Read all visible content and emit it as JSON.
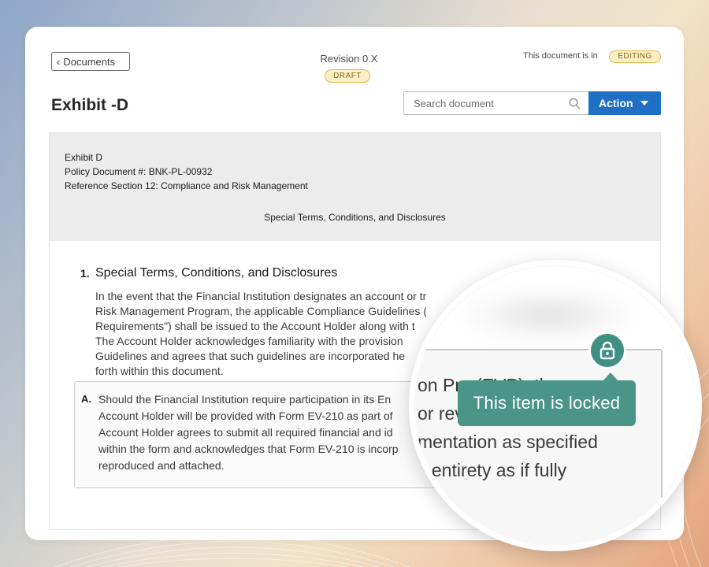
{
  "header": {
    "back_label": "Documents",
    "revision": "Revision 0.X",
    "revision_badge": "DRAFT",
    "status_prefix": "This document is in",
    "status_badge": "EDITING",
    "title": "Exhibit -D"
  },
  "search": {
    "placeholder": "Search document"
  },
  "action": {
    "label": "Action"
  },
  "document": {
    "header_lines": [
      "Exhibit D",
      "Policy Document #: BNK-PL-00932",
      "Reference Section 12: Compliance and Risk Management"
    ],
    "header_center": "Special Terms, Conditions, and Disclosures",
    "section": {
      "number": "1.",
      "title": "Special Terms, Conditions, and Disclosures",
      "paragraph_lines": [
        "In the event that the Financial Institution designates an account or tran",
        "Risk Management Program, the applicable Compliance Guidelines (\"",
        "Requirements\") shall be issued to the Account Holder along with t",
        "The Account Holder acknowledges familiarity with the provision",
        "Guidelines and agrees that such guidelines are incorporated he",
        "forth within this document."
      ]
    },
    "subsection": {
      "letter": "A.",
      "lines": [
        "Should the Financial Institution require participation in its En",
        "Account Holder will be provided with Form EV-210 as part of",
        "Account Holder agrees to submit all required financial and id",
        "within the form and acknowledges that Form EV-210 is incorp",
        "reproduced and attached."
      ]
    }
  },
  "magnifier": {
    "lines": [
      "on Pro          (EVP), th",
      "or rev",
      "mentation as specified",
      "s entirety as if fully"
    ],
    "tooltip": "This item is locked",
    "lock_icon": "lock-icon",
    "accent_color": "#4a9488"
  }
}
